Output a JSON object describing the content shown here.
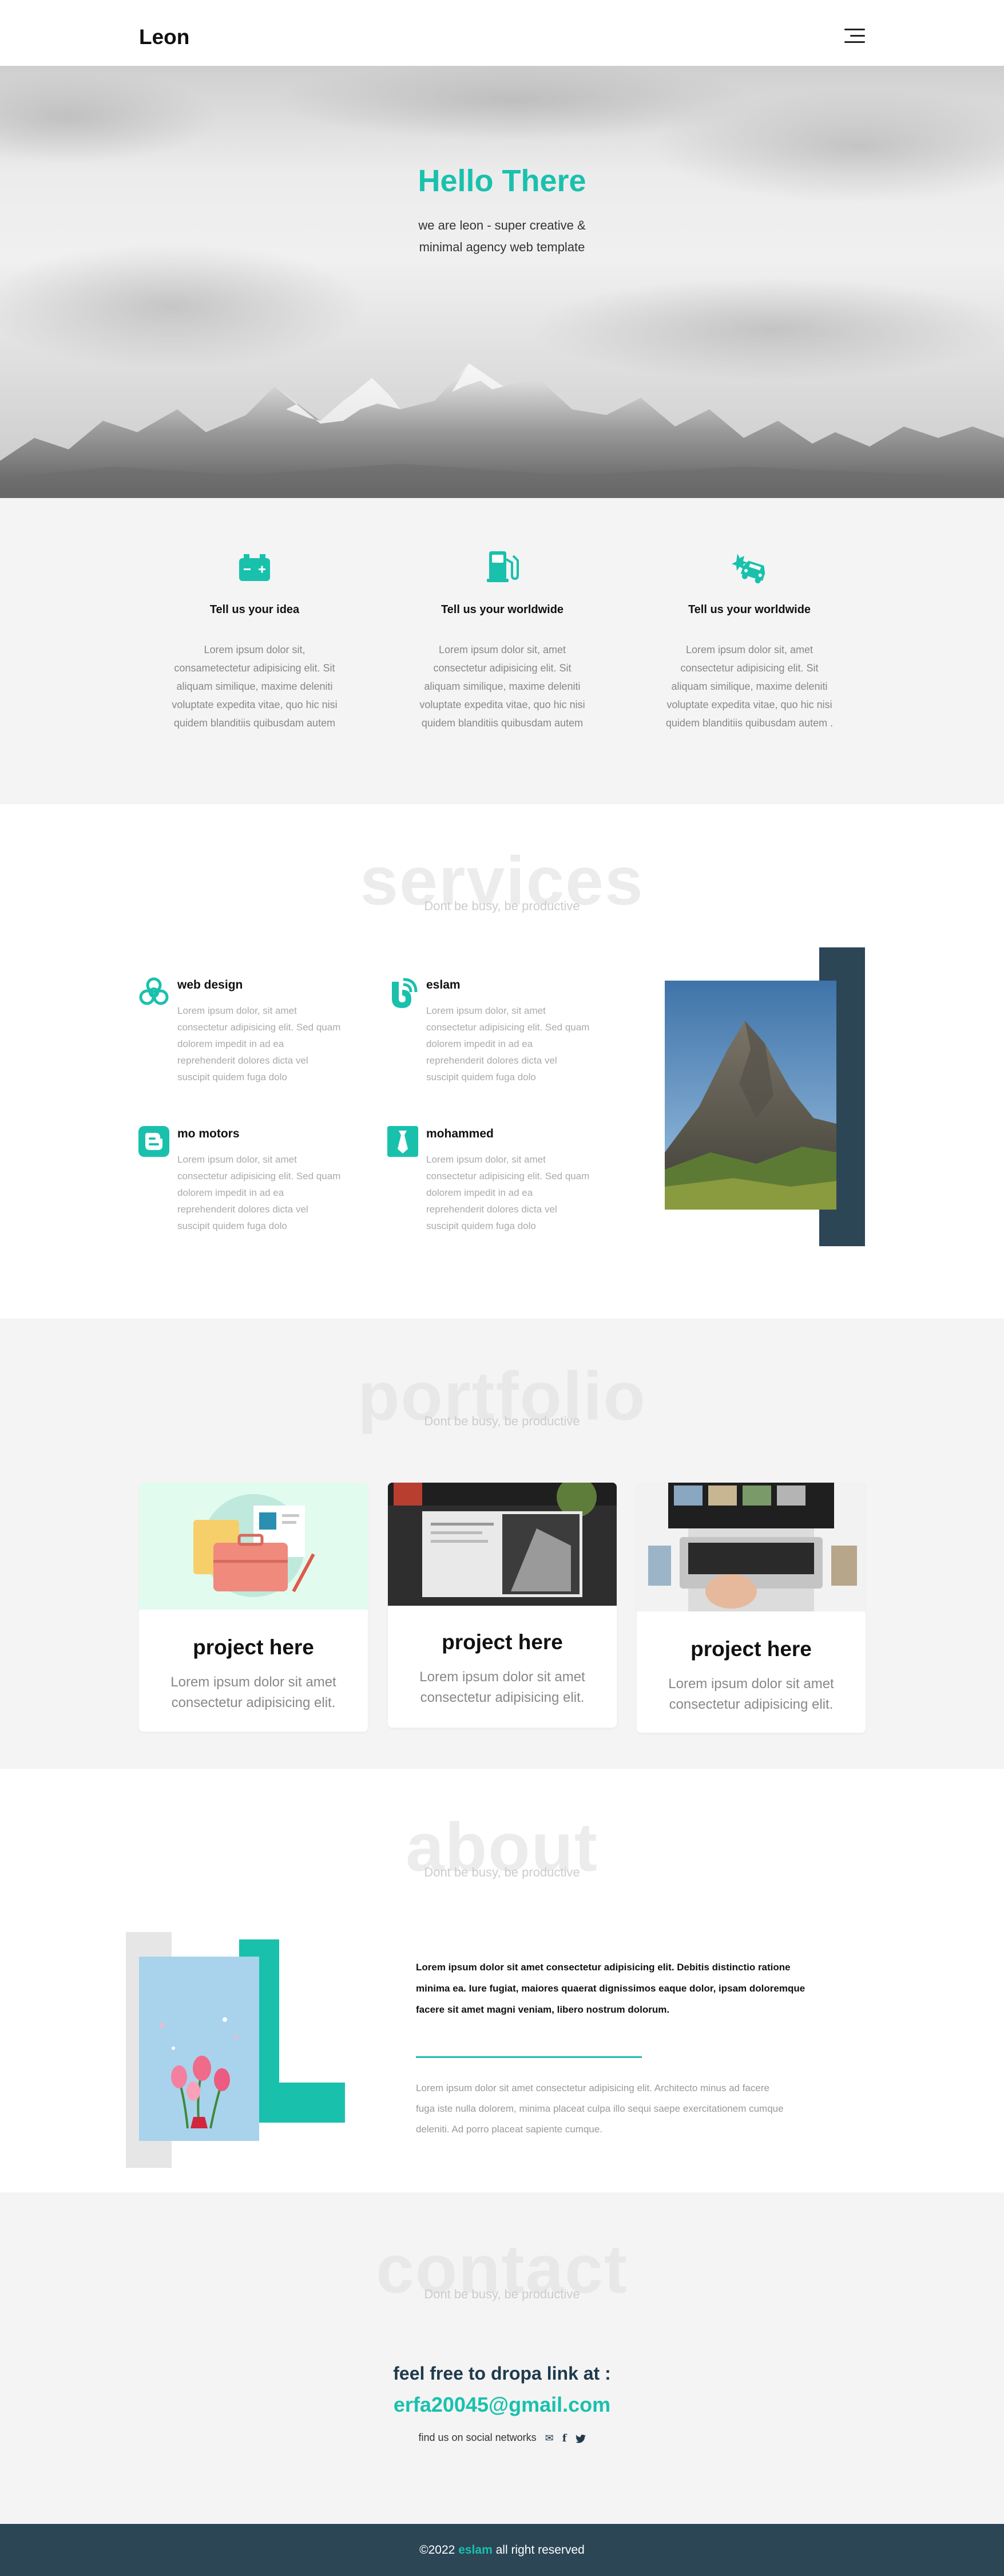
{
  "header": {
    "logo": "Leon",
    "menu_icon": "hamburger-menu-icon"
  },
  "hero": {
    "title": "Hello There",
    "subtitle_line1": "we are leon - super creative &",
    "subtitle_line2": "minimal agency web template"
  },
  "features": [
    {
      "icon": "battery-icon",
      "title": "Tell us your idea",
      "lines": [
        "Lorem ipsum dolor sit,",
        "consametectetur adipisicing elit. Sit",
        "aliquam similique, maxime deleniti",
        "voluptate expedita vitae, quo hic nisi",
        "quidem blanditiis quibusdam autem"
      ]
    },
    {
      "icon": "gas-pump-icon",
      "title": "Tell us your worldwide",
      "lines": [
        "Lorem ipsum dolor sit, amet",
        "consectetur adipisicing elit. Sit",
        "aliquam similique, maxime deleniti",
        "voluptate expedita vitae, quo hic nisi",
        "quidem blanditiis quibusdam autem"
      ]
    },
    {
      "icon": "car-crash-icon",
      "title": "Tell us your worldwide",
      "lines": [
        "Lorem ipsum dolor sit, amet",
        "consectetur adipisicing elit. Sit",
        "aliquam similique, maxime deleniti",
        "voluptate expedita vitae, quo hic nisi",
        "quidem blanditiis quibusdam autem ."
      ]
    }
  ],
  "services": {
    "bg_title": "services",
    "subtitle": "Dont be busy, be productive",
    "items": [
      {
        "icon": "biohazard-icon",
        "title": "web design",
        "lines": [
          "Lorem ipsum dolor, sit amet",
          "consectetur adipisicing elit. Sed quam",
          "dolorem impedit in ad ea",
          "reprehenderit dolores dicta vel",
          "suscipit quidem fuga dolo"
        ]
      },
      {
        "icon": "blogger-b-icon",
        "title": "eslam",
        "lines": [
          "Lorem ipsum dolor, sit amet",
          "consectetur adipisicing elit. Sed quam",
          "dolorem impedit in ad ea",
          "reprehenderit dolores dicta vel",
          "suscipit quidem fuga dolo"
        ]
      },
      {
        "icon": "blogger-icon",
        "title": "mo motors",
        "lines": [
          "Lorem ipsum dolor, sit amet",
          "consectetur adipisicing elit. Sed quam",
          "dolorem impedit in ad ea",
          "reprehenderit dolores dicta vel",
          "suscipit quidem fuga dolo"
        ]
      },
      {
        "icon": "tie-icon",
        "title": "mohammed",
        "lines": [
          "Lorem ipsum dolor, sit amet",
          "consectetur adipisicing elit. Sed quam",
          "dolorem impedit in ad ea",
          "reprehenderit dolores dicta vel",
          "suscipit quidem fuga dolo"
        ]
      }
    ]
  },
  "portfolio": {
    "bg_title": "portfolio",
    "subtitle": "Dont be busy, be productive",
    "cards": [
      {
        "title": "project here",
        "line1": "Lorem ipsum dolor sit amet",
        "line2": "consectetur adipisicing elit."
      },
      {
        "title": "project here",
        "line1": "Lorem ipsum dolor sit amet",
        "line2": "consectetur adipisicing elit."
      },
      {
        "title": "project here",
        "line1": "Lorem ipsum dolor sit amet",
        "line2": "consectetur adipisicing elit."
      }
    ]
  },
  "about": {
    "bg_title": "about",
    "subtitle": "Dont be busy, be productive",
    "bold_lines": [
      "Lorem ipsum dolor sit amet consectetur adipisicing elit. Debitis distinctio ratione",
      "minima ea. Iure fugiat, maiores quaerat dignissimos eaque dolor, ipsam doloremque",
      "facere sit amet magni veniam, libero nostrum dolorum."
    ],
    "text_lines": [
      "Lorem ipsum dolor sit amet consectetur adipisicing elit. Architecto minus ad facere",
      "fuga iste nulla dolorem, minima placeat culpa illo sequi saepe exercitationem cumque",
      "deleniti. Ad porro placeat sapiente cumque."
    ]
  },
  "contact": {
    "bg_title": "contact",
    "subtitle": "Dont be busy, be productive",
    "heading": "feel free to dropa link at :",
    "email": "erfa20045@gmail.com",
    "social_text": "find us on social networks",
    "social_icons": [
      "envelope-icon",
      "facebook-icon",
      "twitter-icon"
    ]
  },
  "footer": {
    "prefix": "©2022",
    "brand": "eslam",
    "suffix": "all right reserved"
  },
  "colors": {
    "accent": "#19c1ad",
    "dark": "#2c4656",
    "light_bg": "#f4f4f4"
  }
}
